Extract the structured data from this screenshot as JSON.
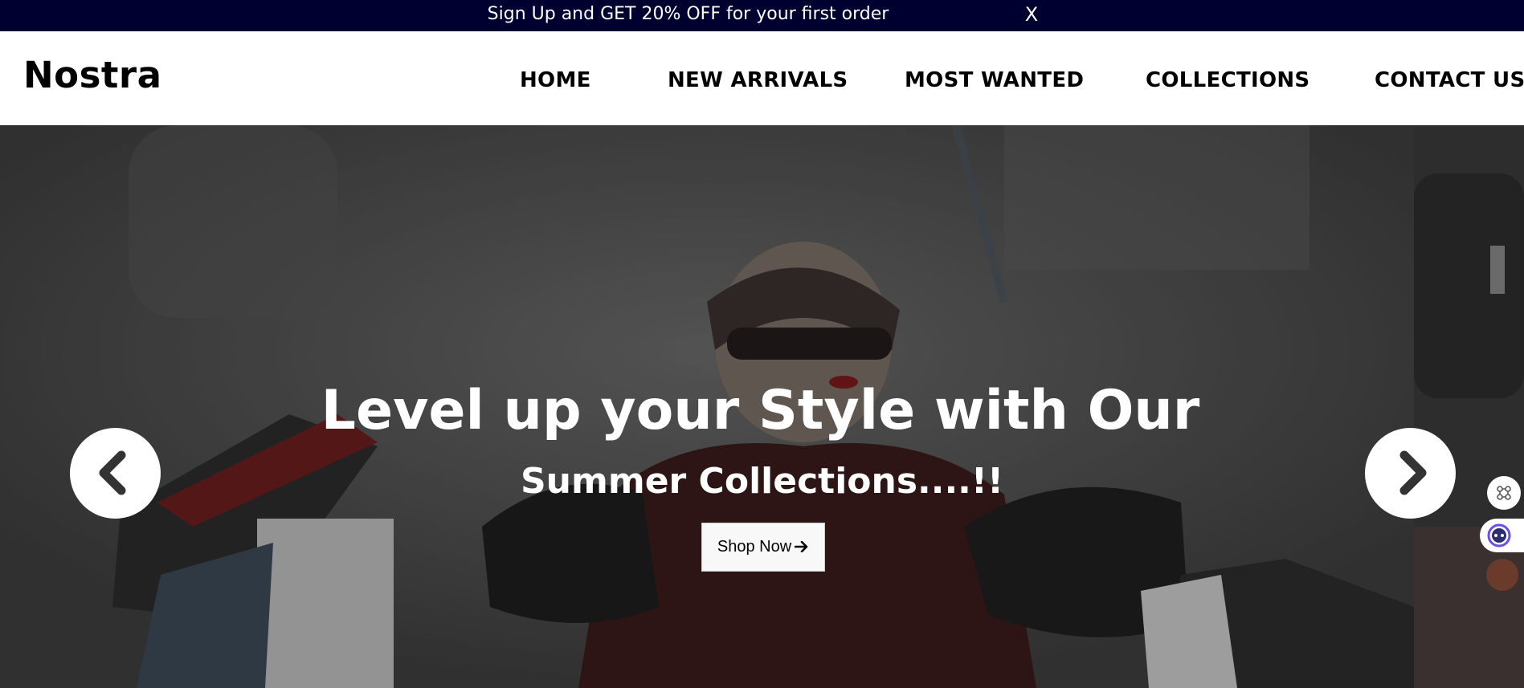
{
  "promo": {
    "text": "Sign Up and GET 20% OFF for your first order",
    "close_label": "X"
  },
  "header": {
    "logo": "Nostra",
    "nav": [
      {
        "label": "HOME"
      },
      {
        "label": "NEW ARRIVALS"
      },
      {
        "label": "MOST WANTED"
      },
      {
        "label": "COLLECTIONS"
      },
      {
        "label": "CONTACT US"
      }
    ]
  },
  "hero": {
    "title": "Level up your Style with Our",
    "subtitle": "Summer Collections....!!",
    "cta_label": "Shop Now",
    "cta_icon": "arrow-right-icon",
    "prev_icon": "chevron-left-icon",
    "next_icon": "chevron-right-icon"
  },
  "widgets": {
    "w1_icon": "command-icon",
    "w2_icon": "assistant-face-icon"
  },
  "colors": {
    "promo_bg": "#000030",
    "text_dark": "#000000",
    "hero_overlay": "#4a4a4a",
    "accent": "#6b4df0"
  }
}
